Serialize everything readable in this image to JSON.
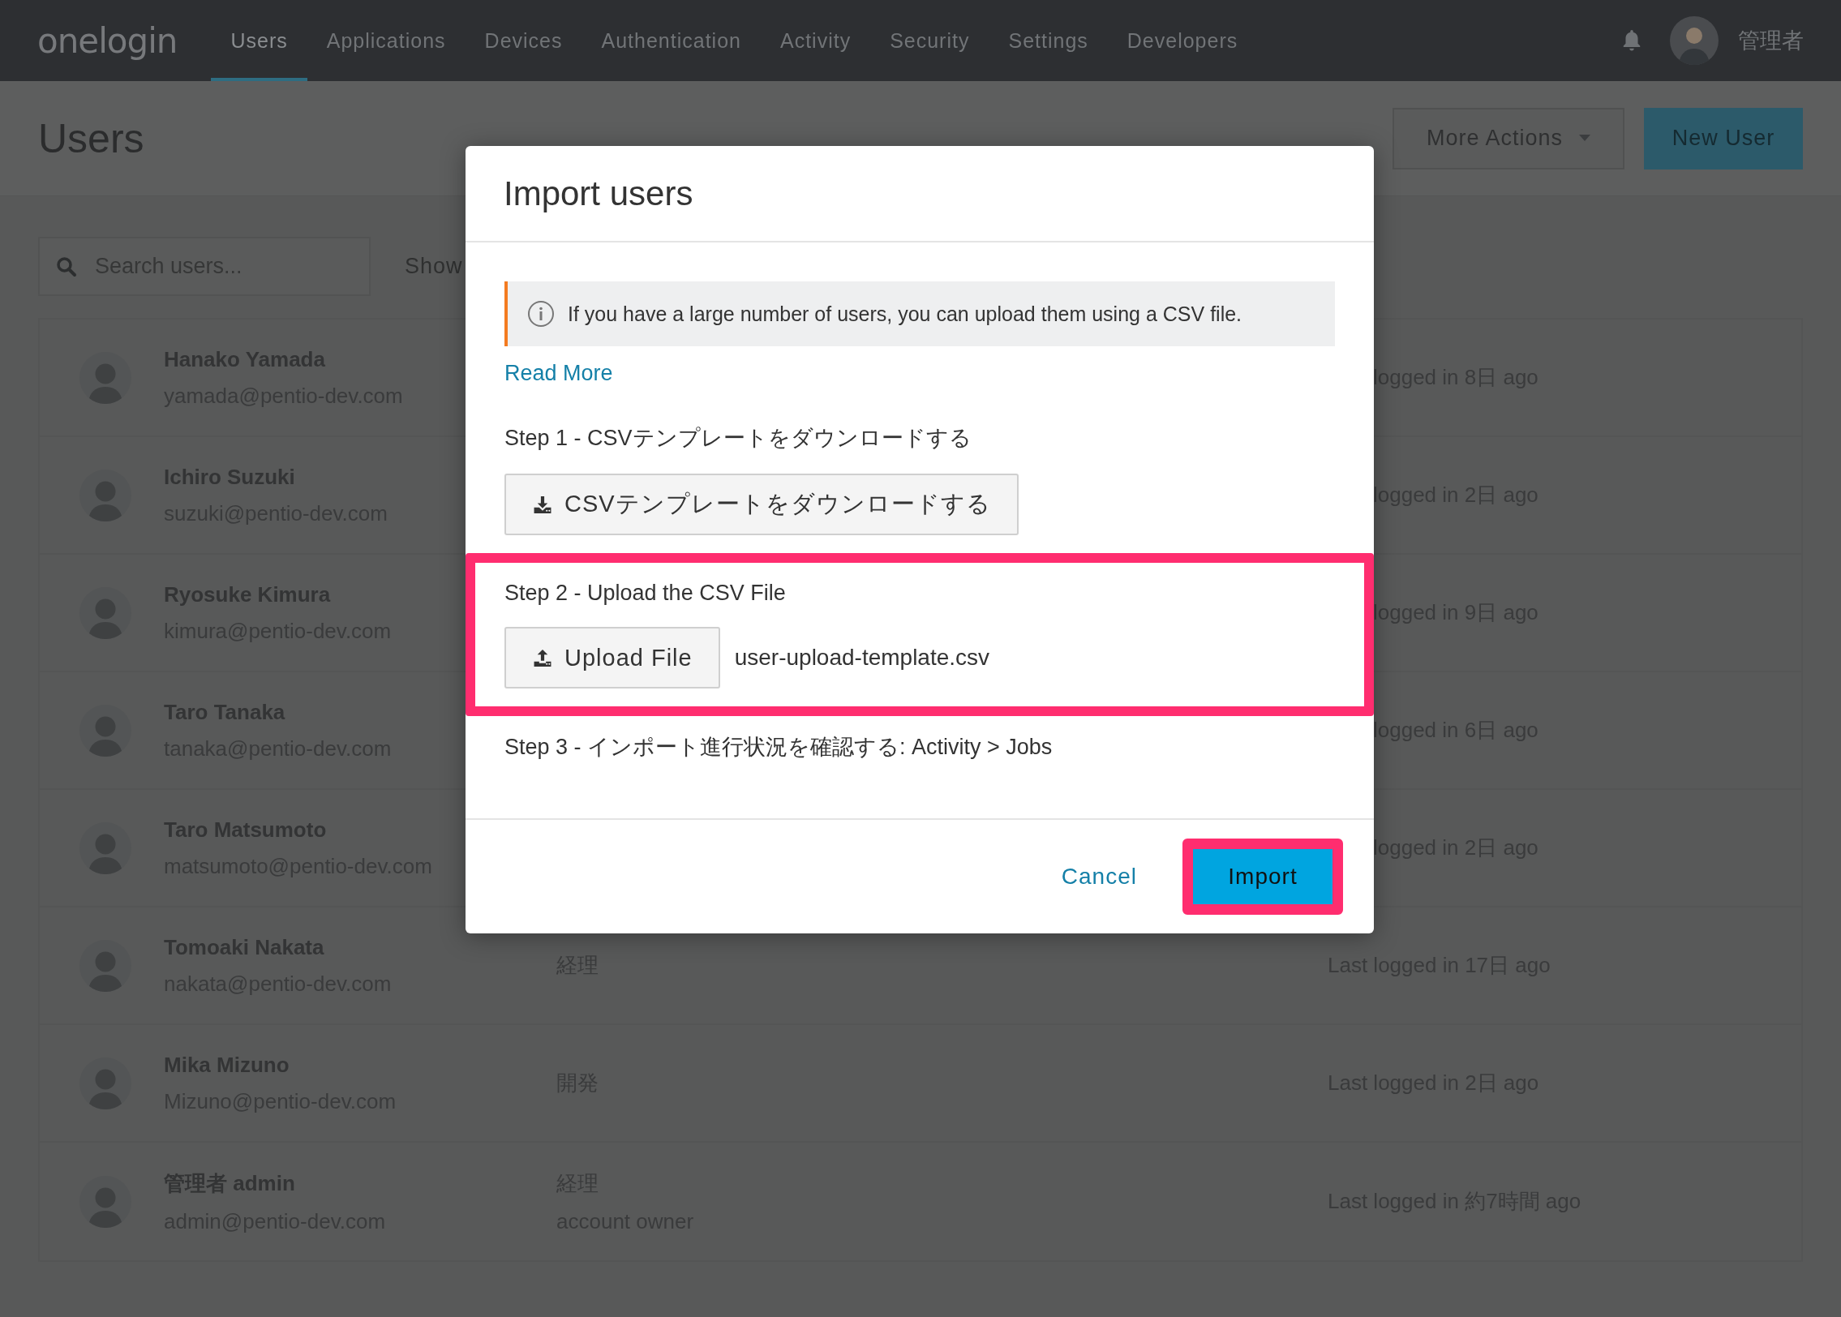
{
  "nav": {
    "logo": "onelogin",
    "items": [
      {
        "label": "Users",
        "selected": true
      },
      {
        "label": "Applications",
        "selected": false
      },
      {
        "label": "Devices",
        "selected": false
      },
      {
        "label": "Authentication",
        "selected": false
      },
      {
        "label": "Activity",
        "selected": false
      },
      {
        "label": "Security",
        "selected": false
      },
      {
        "label": "Settings",
        "selected": false
      },
      {
        "label": "Developers",
        "selected": false
      }
    ],
    "user": "管理者"
  },
  "page": {
    "title": "Users",
    "more_actions": "More Actions",
    "new_user": "New User",
    "search": {
      "placeholder": "Search users..."
    },
    "show_label": "Show"
  },
  "users": [
    {
      "name": "Hanako Yamada",
      "email": "yamada@pentio-dev.com",
      "last_login": "logged in 8日 ago"
    },
    {
      "name": "Ichiro Suzuki",
      "email": "suzuki@pentio-dev.com",
      "last_login": "logged in 2日 ago"
    },
    {
      "name": "Ryosuke Kimura",
      "email": "kimura@pentio-dev.com",
      "last_login": "logged in 9日 ago"
    },
    {
      "name": "Taro Tanaka",
      "email": "tanaka@pentio-dev.com",
      "last_login": "logged in 6日 ago"
    },
    {
      "name": "Taro Matsumoto",
      "email": "matsumoto@pentio-dev.com",
      "last_login": "logged in 2日 ago"
    },
    {
      "name": "Tomoaki Nakata",
      "email": "nakata@pentio-dev.com",
      "department": "経理",
      "last_login": "Last logged in 17日 ago"
    },
    {
      "name": "Mika Mizuno",
      "email": "Mizuno@pentio-dev.com",
      "department": "開発",
      "last_login": "Last logged in 2日 ago"
    },
    {
      "name": "管理者 admin",
      "email": "admin@pentio-dev.com",
      "department": "経理",
      "role": "account owner",
      "last_login": "Last logged in 約7時間 ago"
    }
  ],
  "dialog": {
    "title": "Import users",
    "info": "If you have a large number of users, you can upload them using a CSV file.",
    "read_more": "Read More",
    "steps": [
      {
        "kind": "download",
        "label": "Step 1 - CSVテンプレートをダウンロードする",
        "button": "CSVテンプレートをダウンロードする",
        "highlighted": false
      },
      {
        "kind": "upload",
        "label": "Step 2 - Upload the CSV File",
        "button": "Upload File",
        "file": "user-upload-template.csv",
        "highlighted": true
      },
      {
        "kind": "text",
        "label": "Step 3 - インポート進行状況を確認する: Activity > Jobs",
        "highlighted": false
      }
    ],
    "cancel": "Cancel",
    "import": {
      "label": "Import",
      "highlighted": true
    }
  }
}
